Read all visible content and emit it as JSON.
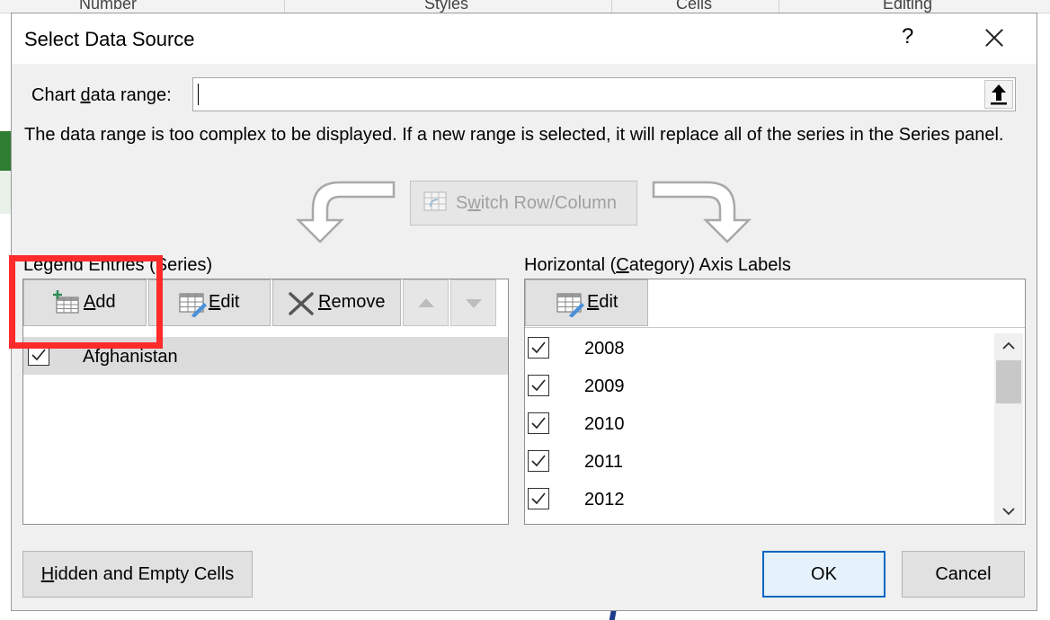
{
  "background": {
    "ribbon_groups": [
      "Number",
      "Styles",
      "Cells",
      "Editing"
    ]
  },
  "dialog": {
    "title": "Select Data Source",
    "help": "?",
    "chart_range": {
      "label": "Chart ",
      "label_u": "d",
      "label_rest": "ata range:",
      "value": ""
    },
    "message": "The data range is too complex to be displayed. If a new range is selected, it will replace all of the series in the Series panel.",
    "switch_button": {
      "u": "w",
      "pre": "S",
      "rest": "itch Row/Column",
      "enabled": false
    },
    "legend": {
      "header": "Legend Entries (Series)",
      "add": {
        "u": "A",
        "rest": "dd"
      },
      "edit": {
        "u": "E",
        "rest": "dit"
      },
      "remove": {
        "u": "R",
        "rest": "emove"
      },
      "series": [
        {
          "name": "Afghanistan",
          "checked": true,
          "selected": true
        }
      ]
    },
    "axis": {
      "header_pre": "Horizontal (",
      "header_u": "C",
      "header_rest": "ategory) Axis Labels",
      "edit": {
        "u": "E",
        "rest": "dit"
      },
      "labels": [
        "2008",
        "2009",
        "2010",
        "2011",
        "2012"
      ]
    },
    "hidden_button": {
      "u": "H",
      "rest": "idden and Empty Cells"
    },
    "ok": "OK",
    "cancel": "Cancel"
  },
  "colors": {
    "highlight": "#ff2a2a",
    "ok_border": "#0067c0"
  }
}
